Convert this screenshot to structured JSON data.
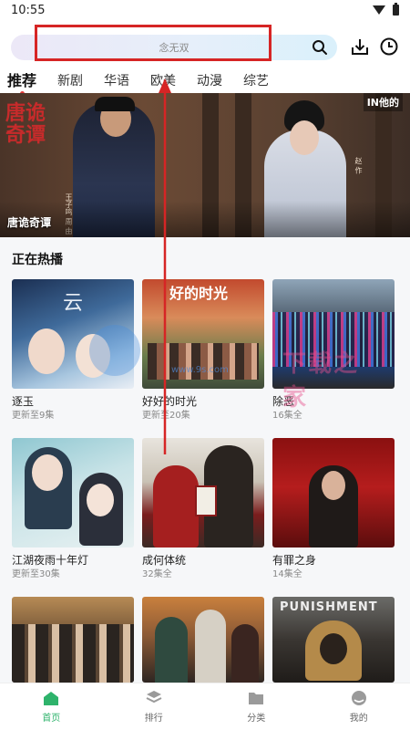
{
  "status_bar": {
    "time": "10:55"
  },
  "header": {
    "search_placeholder": "念无双"
  },
  "tabs": [
    {
      "label": "推荐",
      "active": true
    },
    {
      "label": "新剧",
      "active": false
    },
    {
      "label": "华语",
      "active": false
    },
    {
      "label": "欧美",
      "active": false
    },
    {
      "label": "动漫",
      "active": false
    },
    {
      "label": "综艺",
      "active": false
    }
  ],
  "hero": {
    "caption": "唐诡奇谭",
    "poster_title": "唐诡奇谭",
    "names_left": "王子鸣 周 由",
    "names_right": "赵 作 ",
    "logo": "IN他的"
  },
  "section": {
    "title": "正在热播",
    "items": [
      {
        "name": "逐玉",
        "sub": "更新至9集"
      },
      {
        "name": "好好的时光",
        "sub": "更新至20集"
      },
      {
        "name": "除恶",
        "sub": "16集全"
      },
      {
        "name": "江湖夜雨十年灯",
        "sub": "更新至30集"
      },
      {
        "name": "成何体统",
        "sub": "32集全"
      },
      {
        "name": "有罪之身",
        "sub": "14集全"
      },
      {
        "name": "",
        "sub": ""
      },
      {
        "name": "",
        "sub": ""
      },
      {
        "name": "",
        "sub": "",
        "poster_text": "PUNISHMENT"
      }
    ]
  },
  "watermark": {
    "small": "www.9s.com",
    "big": "下载之家"
  },
  "poster_texts": {
    "t2_top": "好的时光",
    "t1_side": "云"
  },
  "bottom_nav": [
    {
      "label": "首页",
      "icon": "home-icon",
      "active": true
    },
    {
      "label": "排行",
      "icon": "rank-icon",
      "active": false
    },
    {
      "label": "分类",
      "icon": "folder-icon",
      "active": false
    },
    {
      "label": "我的",
      "icon": "profile-icon",
      "active": false
    }
  ],
  "colors": {
    "accent": "#2eb36b",
    "annotation_red": "#d62525"
  }
}
